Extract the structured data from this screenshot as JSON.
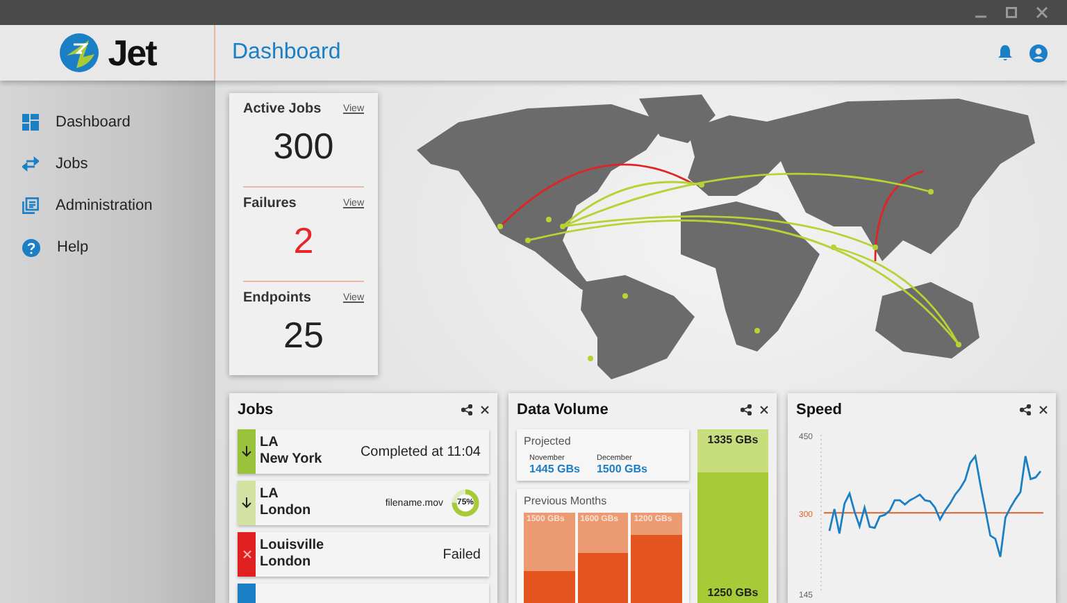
{
  "app": {
    "name": "Jet",
    "page_title": "Dashboard"
  },
  "sidebar": {
    "items": [
      {
        "label": "Dashboard",
        "selected": false
      },
      {
        "label": "Jobs",
        "selected": false
      },
      {
        "label": "Administration",
        "selected": false
      },
      {
        "label": "Help",
        "selected": false
      }
    ]
  },
  "stats": [
    {
      "title": "Active Jobs",
      "link": "View",
      "value": "300",
      "alert": false
    },
    {
      "title": "Failures",
      "link": "View",
      "value": "2",
      "alert": true
    },
    {
      "title": "Endpoints",
      "link": "View",
      "value": "25",
      "alert": false
    }
  ],
  "jobs": {
    "title": "Jobs",
    "rows": [
      {
        "kind": "completed",
        "color": "#9bc23c",
        "from": "LA",
        "to": "New York",
        "status": "Completed at 11:04"
      },
      {
        "kind": "transferring",
        "color": "#d3e2a3",
        "from": "LA",
        "to": "London",
        "file": "filename.mov",
        "progress": "75%",
        "level": 0.75
      },
      {
        "kind": "failed",
        "color": "#e02020",
        "from": "Louisville",
        "to": "London",
        "status": "Failed"
      },
      {
        "kind": "scheduled",
        "color": "#1a7fc4"
      }
    ]
  },
  "data_volume": {
    "title": "Data Volume",
    "projected": {
      "title": "Projected",
      "months": [
        {
          "label": "November",
          "value": "1445 GBs"
        },
        {
          "label": "December",
          "value": "1500 GBs"
        }
      ]
    },
    "previous": {
      "title": "Previous Months",
      "bars": [
        {
          "label": "1500 GBs",
          "level": 0.35
        },
        {
          "label": "1600 GBs",
          "level": 0.55
        },
        {
          "label": "1200 GBs",
          "level": 0.75
        }
      ]
    },
    "current": {
      "top": "1335 GBs",
      "bottom": "1250 GBs",
      "level": 0.75
    }
  },
  "speed": {
    "title": "Speed",
    "chart_data": {
      "type": "line",
      "ylim": [
        145,
        450
      ],
      "yticks": [
        145,
        300,
        450
      ],
      "series": [
        {
          "color": "#1a7fc4",
          "values": [
            265,
            307,
            260,
            318,
            337,
            302,
            274,
            310,
            273,
            271,
            293,
            296,
            304,
            324,
            324,
            316,
            324,
            329,
            335,
            324,
            322,
            310,
            287,
            304,
            318,
            335,
            347,
            363,
            396,
            409,
            355,
            306,
            256,
            250,
            215,
            291,
            310,
            326,
            340,
            409,
            365,
            368,
            380
          ]
        }
      ],
      "ref_lines": [
        {
          "axis": "y",
          "value": 300
        }
      ]
    }
  }
}
